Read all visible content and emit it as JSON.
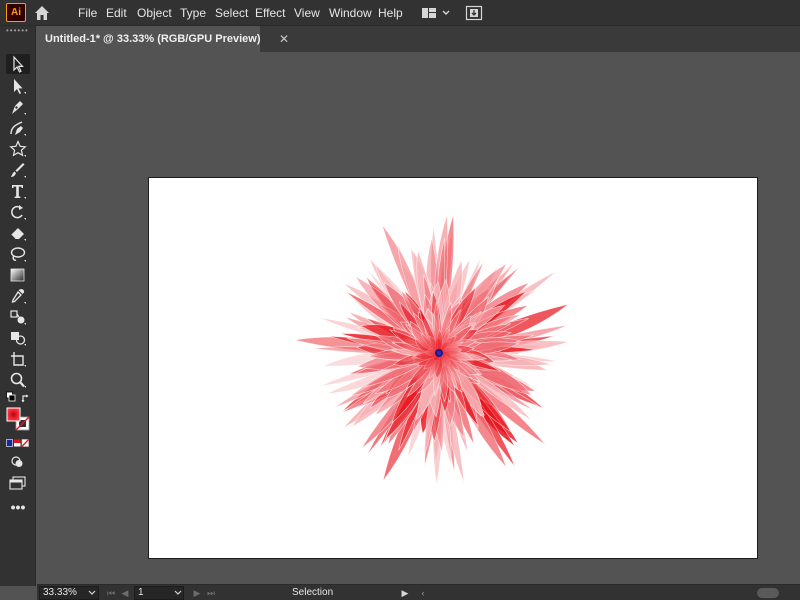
{
  "app": {
    "logo_text": "Ai",
    "accent_color": "#ff9a00"
  },
  "menu": {
    "items": [
      "File",
      "Edit",
      "Object",
      "Type",
      "Select",
      "Effect",
      "View",
      "Window",
      "Help"
    ]
  },
  "document_tab": {
    "title": "Untitled-1* @ 33.33% (RGB/GPU Preview)",
    "close_glyph": "✕"
  },
  "toolbar": {
    "grip_glyph": "••••••",
    "tools": [
      "selection-tool",
      "direct-selection-tool",
      "pen-tool",
      "curvature-tool",
      "shaper-star-tool",
      "paintbrush-tool",
      "type-tool",
      "rotate-tool",
      "eraser-tool",
      "lasso-tool",
      "gradient-tool",
      "eyedropper-tool",
      "blend-tool",
      "shape-builder-tool",
      "artboard-tool",
      "zoom-tool",
      "fill-stroke-swap",
      "fill-color-swatch",
      "color-mode-icons",
      "draw-mode-icon",
      "screen-mode-icon",
      "more-tools"
    ],
    "more_label": "•••",
    "fill_color": "#e8121b"
  },
  "canvas": {
    "artboard_color": "#ffffff",
    "pasteboard_color": "#535353",
    "artwork": "red-chrysanthemum-flower",
    "artwork_colors": [
      "#e8121b",
      "#f06b73",
      "#f6b1b5",
      "#1a1a8c"
    ]
  },
  "status": {
    "zoom": "33.33%",
    "artboard_number": "1",
    "current_tool": "Selection"
  }
}
